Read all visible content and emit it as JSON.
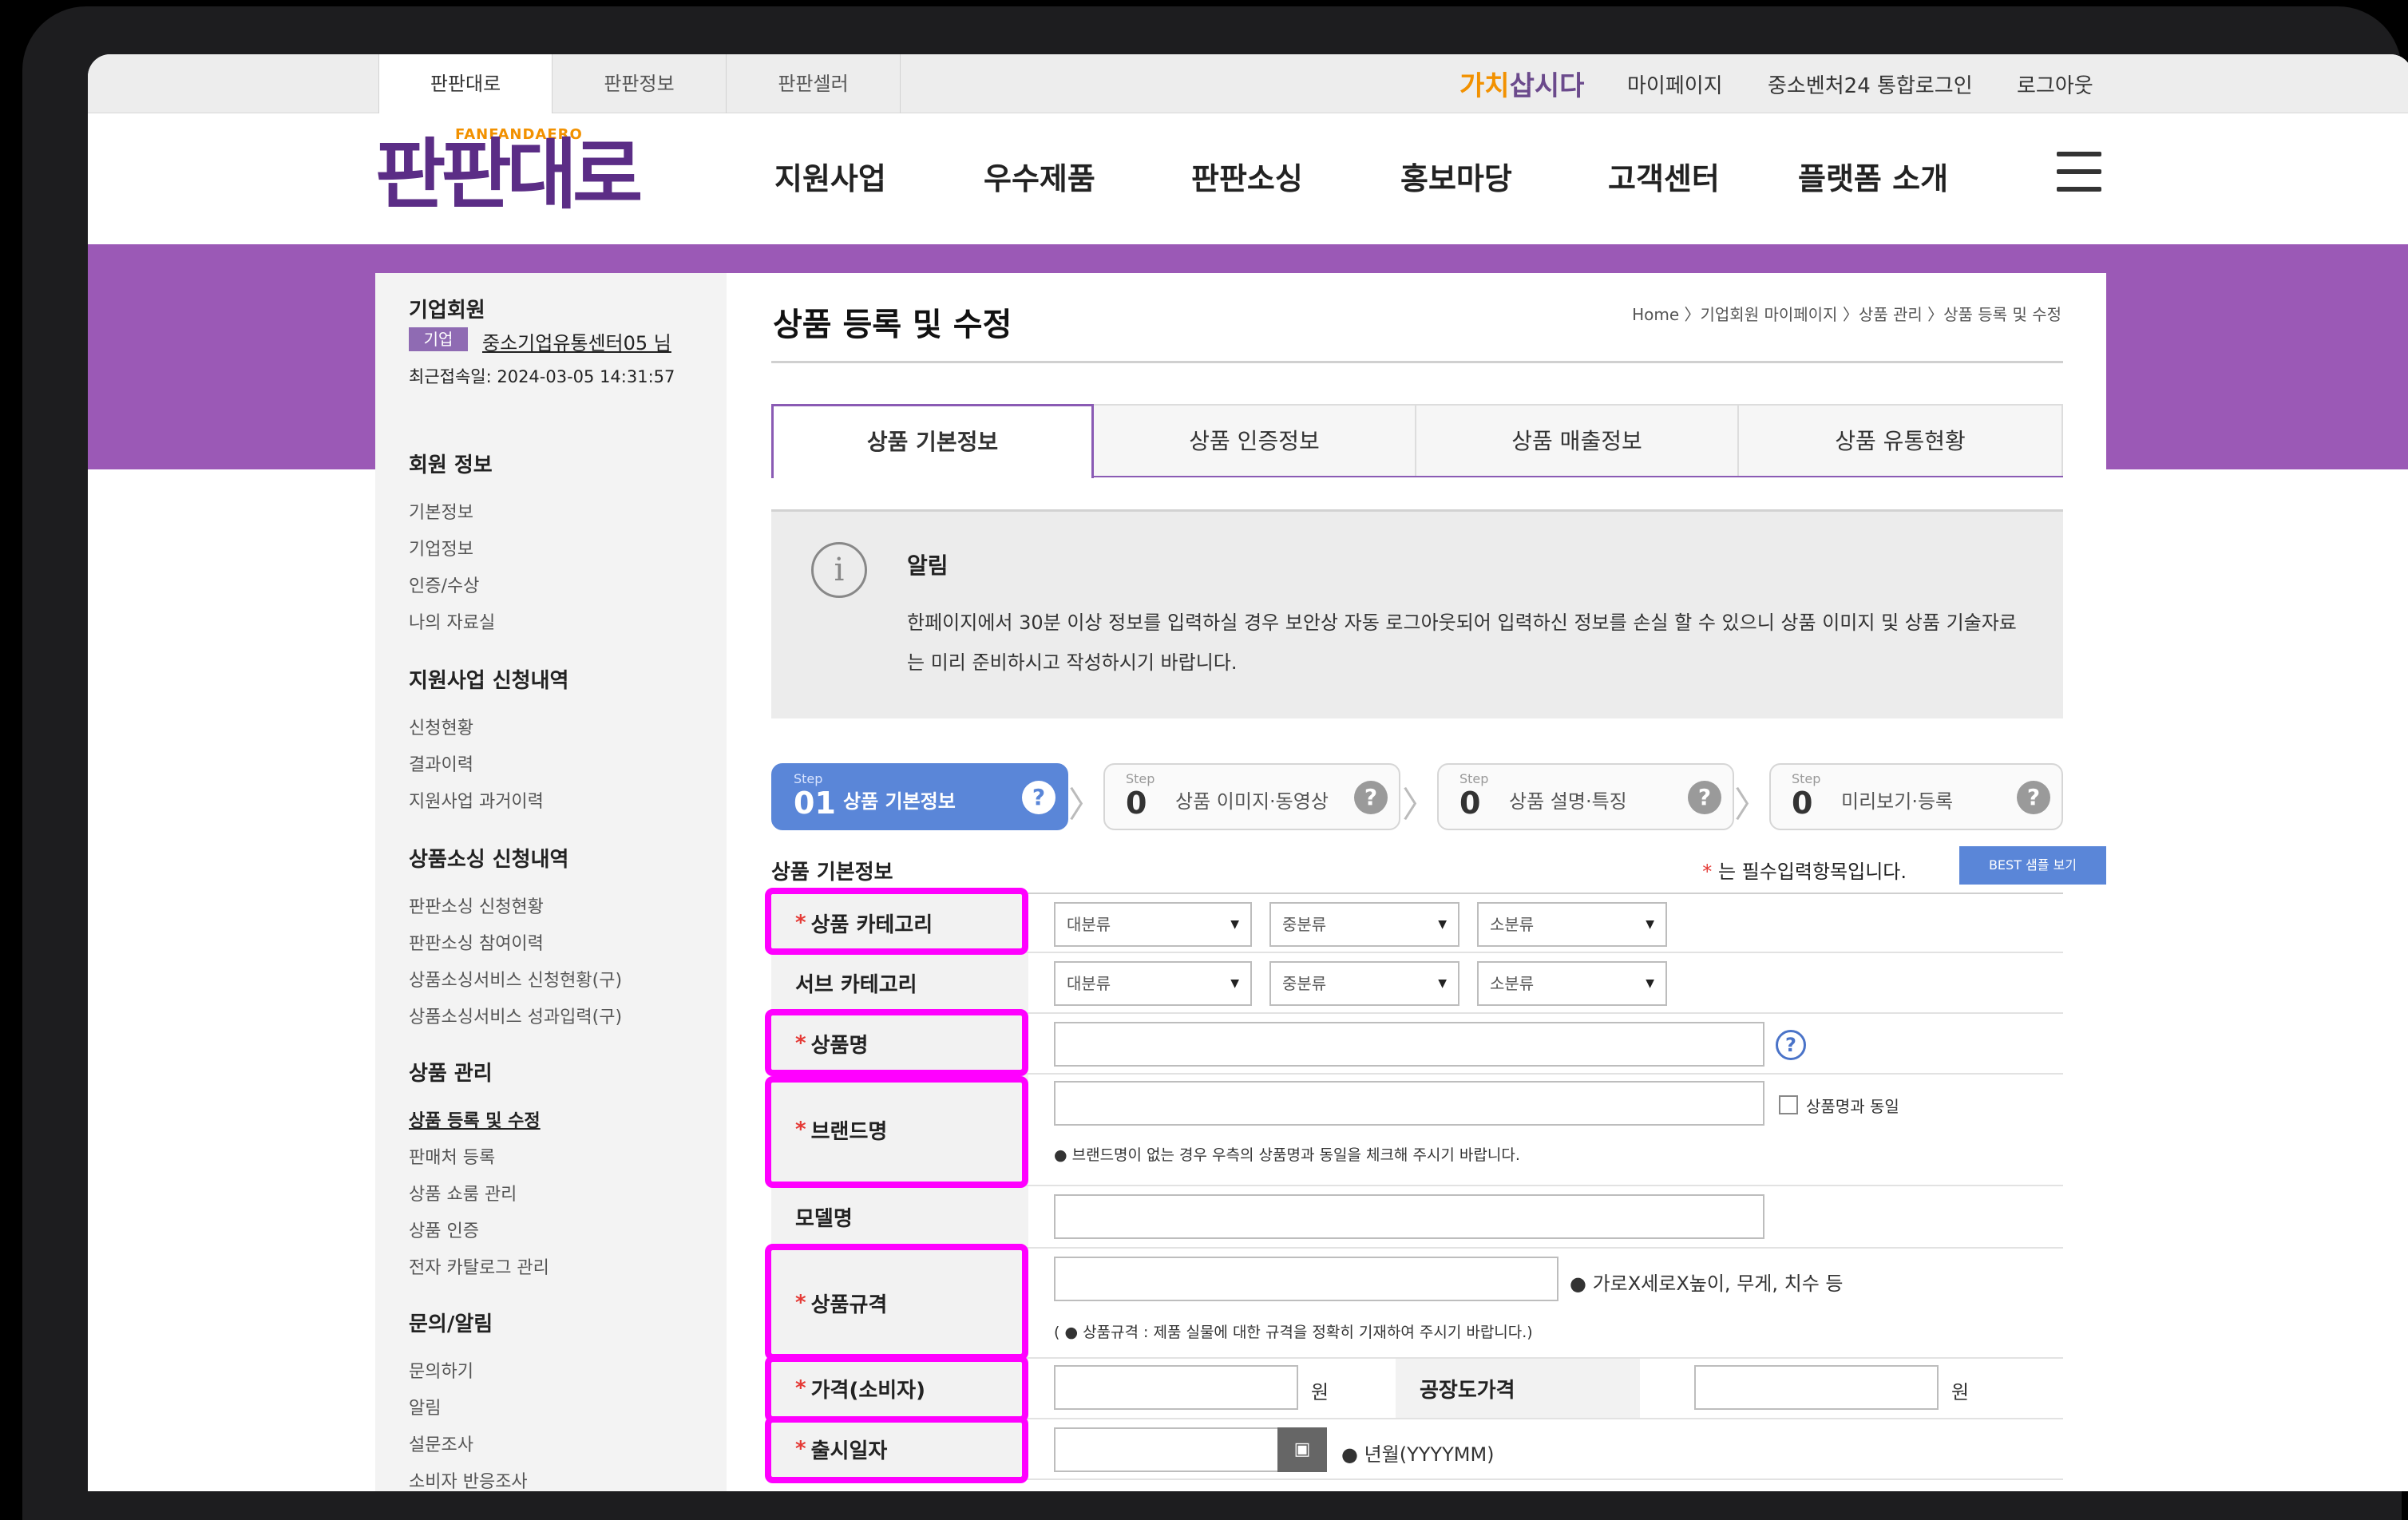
{
  "topbar": {
    "tabs": [
      "판판대로",
      "판판정보",
      "판판셀러"
    ],
    "gachi_brand": {
      "part1": "가치",
      "part2": "삽시다"
    },
    "util_links": [
      "마이페이지",
      "중소벤처24 통합로그인",
      "로그아웃"
    ]
  },
  "header": {
    "logo": {
      "small": "FANFANDAERO",
      "big": "판판대로"
    },
    "nav": [
      "지원사업",
      "우수제품",
      "판판소싱",
      "홍보마당",
      "고객센터",
      "플랫폼 소개"
    ]
  },
  "sidebar": {
    "member_type": "기업회원",
    "badge": "기업",
    "user_name": "중소기업유통센터05 님",
    "last_login": "최근접속일: 2024-03-05 14:31:57",
    "sections": [
      {
        "title": "회원 정보",
        "items": [
          "기본정보",
          "기업정보",
          "인증/수상",
          "나의 자료실"
        ]
      },
      {
        "title": "지원사업 신청내역",
        "items": [
          "신청현황",
          "결과이력",
          "지원사업 과거이력"
        ]
      },
      {
        "title": "상품소싱 신청내역",
        "items": [
          "판판소싱 신청현황",
          "판판소싱 참여이력",
          "상품소싱서비스 신청현황(구)",
          "상품소싱서비스 성과입력(구)"
        ]
      },
      {
        "title": "상품 관리",
        "items": [
          "상품 등록 및 수정",
          "판매처 등록",
          "상품 쇼룸 관리",
          "상품 인증",
          "전자 카탈로그 관리"
        ]
      },
      {
        "title": "문의/알림",
        "items": [
          "문의하기",
          "알림",
          "설문조사",
          "소비자 반응조사"
        ]
      }
    ]
  },
  "main": {
    "title": "상품 등록 및 수정",
    "breadcrumb": "Home 〉기업회원 마이페이지 〉상품 관리 〉상품 등록 및 수정",
    "tabs": [
      "상품 기본정보",
      "상품 인증정보",
      "상품 매출정보",
      "상품 유통현황"
    ],
    "notice": {
      "title": "알림",
      "body": "한페이지에서 30분 이상 정보를 입력하실 경우 보안상 자동 로그아웃되어 입력하신 정보를 손실 할 수 있으니 상품 이미지 및 상품 기술자료는 미리 준비하시고 작성하시기 바랍니다."
    },
    "steps": [
      {
        "label": "Step",
        "num": "01",
        "name": "상품 기본정보"
      },
      {
        "label": "Step",
        "num": "0",
        "name": "상품 이미지·동영상"
      },
      {
        "label": "Step",
        "num": "0",
        "name": "상품 설명·특징"
      },
      {
        "label": "Step",
        "num": "0",
        "name": "미리보기·등록"
      }
    ],
    "section_title": "상품 기본정보",
    "required_note": "는 필수입력항목입니다.",
    "best_button": "BEST 샘플 보기",
    "form": {
      "category_label": "상품 카테고리",
      "subcategory_label": "서브 카테고리",
      "select_large": "대분류",
      "select_mid": "중분류",
      "select_small": "소분류",
      "name_label": "상품명",
      "brand_label": "브랜드명",
      "brand_same": "상품명과 동일",
      "brand_hint": "● 브랜드명이 없는 경우 우측의 상품명과 동일을 체크해 주시기 바랍니다.",
      "model_label": "모델명",
      "spec_label": "상품규격",
      "spec_hint_right": "● 가로X세로X높이, 무게, 치수 등",
      "spec_hint_below": "( ● 상품규격 : 제품 실물에 대한 규격을 정확히 기재하여 주시기 바랍니다.)",
      "price_label": "가격(소비자)",
      "won": "원",
      "factory_price_label": "공장도가격",
      "release_label": "출시일자",
      "release_hint": "● 년월(YYYYMM)"
    }
  }
}
